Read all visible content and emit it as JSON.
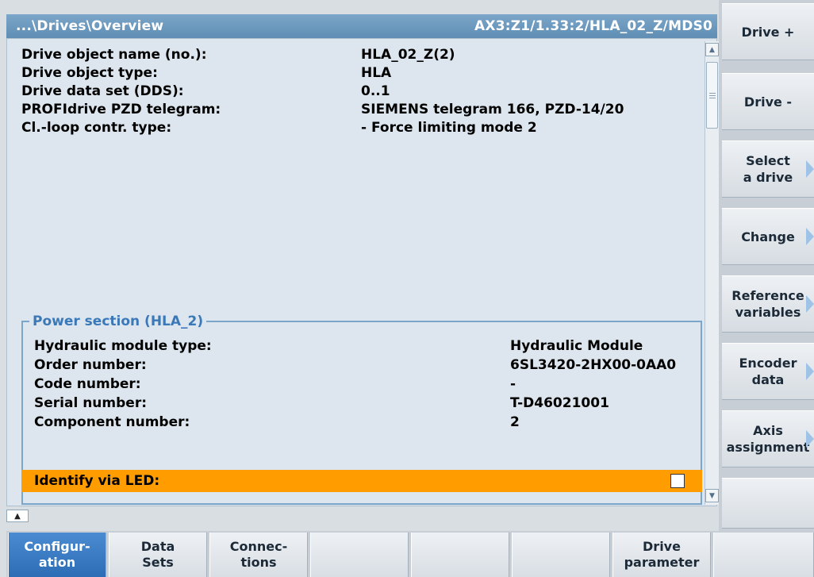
{
  "header": {
    "path": "...\\Drives\\Overview",
    "axis": "AX3:Z1/1.33:2/HLA_02_Z/MDS0"
  },
  "overview": [
    {
      "label": "Drive object name (no.):",
      "value": "HLA_02_Z(2)"
    },
    {
      "label": "Drive object type:",
      "value": "HLA"
    },
    {
      "label": "Drive data set (DDS):",
      "value": "0..1"
    },
    {
      "label": "PROFIdrive PZD telegram:",
      "value": "SIEMENS telegram 166, PZD-14/20"
    },
    {
      "label": "Cl.-loop contr. type:",
      "value": "- Force limiting mode 2"
    }
  ],
  "power_section": {
    "title": "Power section (HLA_2)",
    "rows": [
      {
        "label": "Hydraulic module type:",
        "value": "Hydraulic Module"
      },
      {
        "label": "Order number:",
        "value": "6SL3420-2HX00-0AA0"
      },
      {
        "label": "Code number:",
        "value": "-"
      },
      {
        "label": "Serial number:",
        "value": "T-D46021001"
      },
      {
        "label": "Component number:",
        "value": "2"
      }
    ],
    "identify_led": {
      "label": "Identify via LED:",
      "checked": false
    }
  },
  "vertical_softkeys": [
    {
      "line1": "Drive +",
      "line2": "",
      "arrow": false
    },
    {
      "line1": "Drive -",
      "line2": "",
      "arrow": false
    },
    {
      "line1": "Select",
      "line2": "a drive",
      "arrow": true
    },
    {
      "line1": "Change",
      "line2": "",
      "arrow": true
    },
    {
      "line1": "Reference",
      "line2": "variables",
      "arrow": true
    },
    {
      "line1": "Encoder",
      "line2": "data",
      "arrow": true
    },
    {
      "line1": "Axis",
      "line2": "assignment",
      "arrow": true
    },
    {
      "line1": "",
      "line2": "",
      "arrow": false
    }
  ],
  "horizontal_softkeys": [
    {
      "line1": "Configur-",
      "line2": "ation",
      "active": true
    },
    {
      "line1": "Data",
      "line2": "Sets",
      "active": false
    },
    {
      "line1": "Connec-",
      "line2": "tions",
      "active": false
    },
    {
      "line1": "",
      "line2": "",
      "active": false
    },
    {
      "line1": "",
      "line2": "",
      "active": false
    },
    {
      "line1": "",
      "line2": "",
      "active": false
    },
    {
      "line1": "Drive",
      "line2": "parameter",
      "active": false
    },
    {
      "line1": "",
      "line2": "",
      "active": false
    }
  ],
  "colors": {
    "header": "#6f9cc2",
    "highlight_row": "#ff9c00",
    "group_title": "#3a78b8",
    "active_softkey": "#3a7cc4"
  }
}
